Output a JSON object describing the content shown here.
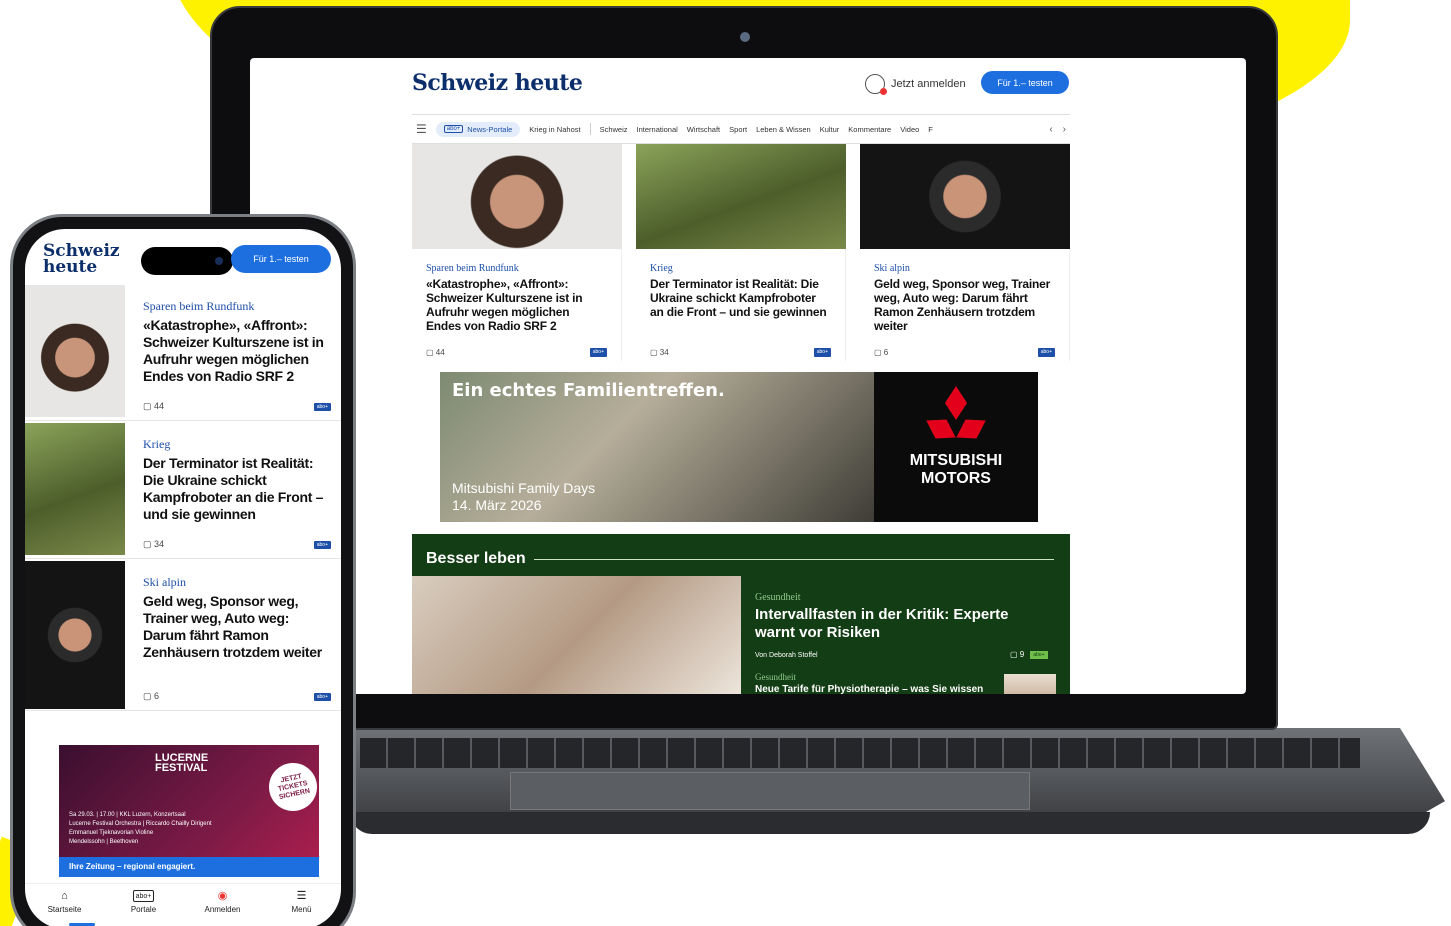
{
  "site": {
    "logo": "Schweiz heute",
    "login_label": "Jetzt anmelden",
    "cta_label": "Für 1.– testen"
  },
  "nav": {
    "menu_glyph": "☰",
    "pill_tag": "abo+",
    "pill_label": "News-Portale",
    "items": [
      "Krieg in Nahost",
      "Schweiz",
      "International",
      "Wirtschaft",
      "Sport",
      "Leben & Wissen",
      "Kultur",
      "Kommentare",
      "Video",
      "F"
    ],
    "prev": "‹",
    "next": "›"
  },
  "articles": [
    {
      "kicker": "Sparen beim Rundfunk",
      "headline": "«Katastrophe», «Affront»: Schweizer Kulturszene ist in Aufruhr wegen möglichen Endes von Radio SRF 2",
      "comments": "44",
      "badge": "abo+"
    },
    {
      "kicker": "Krieg",
      "headline": "Der Terminator ist Realität: Die Ukraine schickt Kampfroboter an die Front – und sie gewinnen",
      "comments": "34",
      "badge": "abo+"
    },
    {
      "kicker": "Ski alpin",
      "headline": "Geld weg, Sponsor weg, Trainer weg, Auto weg: Darum fährt Ramon Zenhäusern trotzdem weiter",
      "comments": "6",
      "badge": "abo+"
    }
  ],
  "ad": {
    "headline": "Ein echtes Familientreffen.",
    "line1": "Mitsubishi Family Days",
    "line2": "14. März 2026",
    "brand": "MITSUBISHI MOTORS",
    "brand_color": "#e2001a"
  },
  "section": {
    "title": "Besser leben",
    "kicker": "Gesundheit",
    "headline": "Intervallfasten in der Kritik: Experte warnt vor Risiken",
    "author": "Von Deborah Stoffel",
    "comments": "9",
    "badge": "abo+",
    "kicker2": "Gesundheit",
    "headline2": "Neue Tarife für Physiotherapie – was Sie wissen",
    "bg_color": "#133d14"
  },
  "phone": {
    "logo": "Schweiz heute",
    "cta_label": "Für 1.– testen",
    "ad": {
      "title": "LUCERNE FESTIVAL",
      "badge": "JETZT TICKETS SICHERN",
      "line1": "Sa 29.03. | 17.00 | KKL Luzern, Konzertsaal",
      "line2": "Lucerne Festival Orchestra | Riccardo Chailly Dirigent",
      "line3": "Emmanuel Tjeknavorian Violine",
      "line4": "Mendelssohn | Beethoven",
      "footer": "Ihre Zeitung – regional engagiert."
    },
    "tabs": [
      {
        "icon": "⌂",
        "label": "Startseite"
      },
      {
        "icon": "abo+",
        "label": "Portale"
      },
      {
        "icon": "◉",
        "label": "Anmelden"
      },
      {
        "icon": "☰",
        "label": "Menü"
      }
    ]
  },
  "colors": {
    "brand_blue": "#1d6fe0",
    "logo_navy": "#0c2f6b",
    "accent_yellow": "#fff200"
  }
}
